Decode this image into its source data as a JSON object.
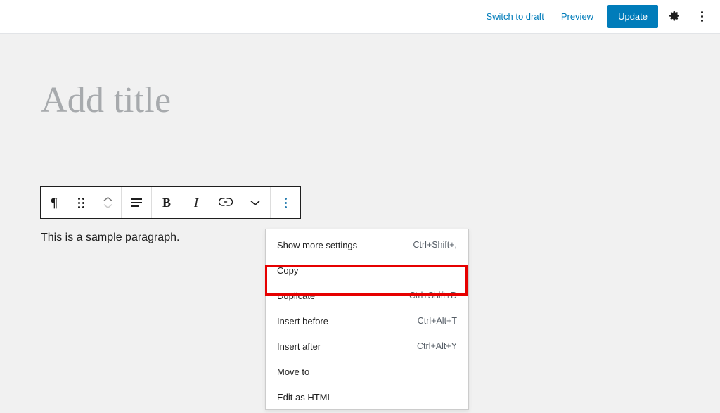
{
  "header": {
    "switch_to_draft_label": "Switch to draft",
    "preview_label": "Preview",
    "update_label": "Update",
    "settings_icon": "gear-icon",
    "more_icon": "more-options-vertical-dots-icon",
    "accent_color": "#007cba"
  },
  "canvas": {
    "title_placeholder": "Add title",
    "paragraph_text": "This is a sample paragraph."
  },
  "block_toolbar": {
    "buttons": [
      {
        "name": "block-type-paragraph",
        "icon": "paragraph-pilcrow-icon",
        "glyph": "¶"
      },
      {
        "name": "drag-handle",
        "icon": "drag-handle-dots-icon"
      },
      {
        "name": "move-up-down",
        "icon": "chevron-up-down-icon"
      },
      {
        "name": "align-text",
        "icon": "align-left-icon"
      },
      {
        "name": "bold",
        "icon": "bold-icon",
        "glyph": "B"
      },
      {
        "name": "italic",
        "icon": "italic-icon",
        "glyph": "I"
      },
      {
        "name": "link",
        "icon": "link-chain-icon"
      },
      {
        "name": "more-rich-text",
        "icon": "chevron-down-icon"
      },
      {
        "name": "block-options",
        "icon": "more-options-vertical-dots-icon"
      }
    ]
  },
  "block_menu": {
    "items": [
      {
        "label": "Show more settings",
        "shortcut": "Ctrl+Shift+,",
        "highlighted": true
      },
      {
        "label": "Copy",
        "shortcut": ""
      },
      {
        "label": "Duplicate",
        "shortcut": "Ctrl+Shift+D"
      },
      {
        "label": "Insert before",
        "shortcut": "Ctrl+Alt+T"
      },
      {
        "label": "Insert after",
        "shortcut": "Ctrl+Alt+Y"
      },
      {
        "label": "Move to",
        "shortcut": ""
      },
      {
        "label": "Edit as HTML",
        "shortcut": ""
      }
    ]
  },
  "annotation": {
    "highlight_color": "#e60000"
  }
}
